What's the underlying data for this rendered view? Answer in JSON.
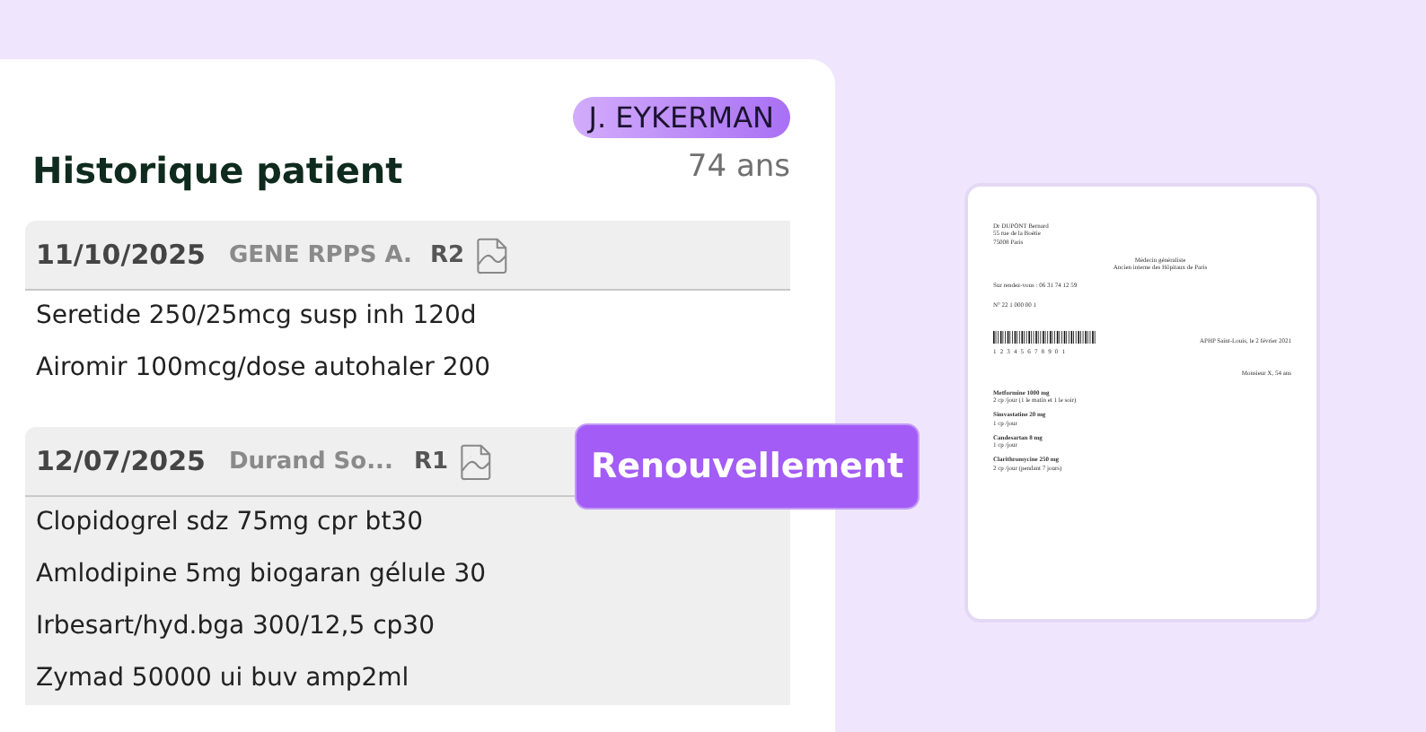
{
  "panel": {
    "title": "Historique patient",
    "patient_name": "J. EYKERMAN",
    "patient_age": "74 ans"
  },
  "prescriptions": [
    {
      "date": "11/10/2025",
      "doctor": "GENE RPPS A.",
      "renewal": "R2",
      "selected": false,
      "items": [
        "Seretide 250/25mcg susp inh 120d",
        "Airomir 100mcg/dose autohaler 200"
      ]
    },
    {
      "date": "12/07/2025",
      "doctor": "Durand So...",
      "renewal": "R1",
      "selected": true,
      "items": [
        "Clopidogrel sdz 75mg cpr bt30",
        "Amlodipine 5mg biogaran gélule 30",
        "Irbesart/hyd.bga 300/12,5 cp30",
        "Zymad 50000 ui buv amp2ml"
      ]
    }
  ],
  "action_button": "Renouvellement",
  "document": {
    "doctor_lines": [
      "Dr DUPONT Bernard",
      "55 rue de la Boétie",
      "75008 Paris"
    ],
    "specialty_lines": [
      "Médecin généraliste",
      "Ancien interne des Hôpitaux de Paris"
    ],
    "phone": "Sur rendez-vous : 06 31 74 12 59",
    "number": "N° 22 1 000 00 1",
    "barcode_digits": "1 2 3 4 5 6 7 8 9 0 1",
    "place_date": "APHP Saint-Louis, le 2 février 2021",
    "patient": "Monsieur X, 54 ans",
    "medications": [
      {
        "name": "Metformine 1000 mg",
        "dosage": "2 cp /jour (1 le matin et 1 le soir)"
      },
      {
        "name": "Simvastatine 20 mg",
        "dosage": "1 cp /jour"
      },
      {
        "name": "Candesartan 8 mg",
        "dosage": "1 cp /jour"
      },
      {
        "name": "Clarithromycine 250 mg",
        "dosage": "2 cp /jour (pendant 7 jours)"
      }
    ]
  }
}
